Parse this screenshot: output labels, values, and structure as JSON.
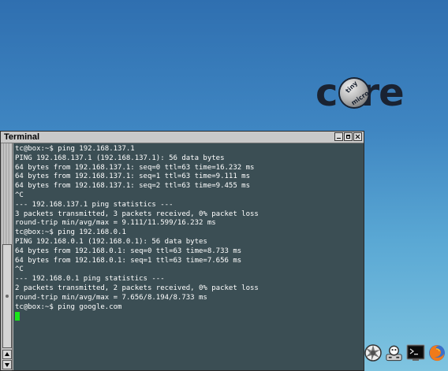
{
  "desktop": {
    "logo": {
      "prefix": "c",
      "suffix": "re",
      "ball_top": "tiny",
      "ball_bottom": "micro"
    }
  },
  "window": {
    "title": "Terminal",
    "buttons": [
      "minimize",
      "maximize",
      "close"
    ]
  },
  "terminal": {
    "lines": [
      "tc@box:~$ ping 192.168.137.1",
      "PING 192.168.137.1 (192.168.137.1): 56 data bytes",
      "64 bytes from 192.168.137.1: seq=0 ttl=63 time=16.232 ms",
      "64 bytes from 192.168.137.1: seq=1 ttl=63 time=9.111 ms",
      "64 bytes from 192.168.137.1: seq=2 ttl=63 time=9.455 ms",
      "^C",
      "--- 192.168.137.1 ping statistics ---",
      "3 packets transmitted, 3 packets received, 0% packet loss",
      "round-trip min/avg/max = 9.111/11.599/16.232 ms",
      "tc@box:~$ ping 192.168.0.1",
      "PING 192.168.0.1 (192.168.0.1): 56 data bytes",
      "64 bytes from 192.168.0.1: seq=0 ttl=63 time=8.733 ms",
      "64 bytes from 192.168.0.1: seq=1 ttl=63 time=7.656 ms",
      "^C",
      "--- 192.168.0.1 ping statistics ---",
      "2 packets transmitted, 2 packets received, 0% packet loss",
      "round-trip min/avg/max = 7.656/8.194/8.733 ms",
      "tc@box:~$ ping google.com"
    ]
  },
  "dock": {
    "icons": [
      "apps-icon",
      "control-panel-icon",
      "terminal-icon",
      "firefox-icon"
    ]
  },
  "colors": {
    "terminal_bg": "#3b4e54",
    "terminal_fg": "#ffffff",
    "cursor": "#19e619",
    "desktop_top": "#2f6fb0",
    "desktop_bottom": "#7fc4e0"
  }
}
